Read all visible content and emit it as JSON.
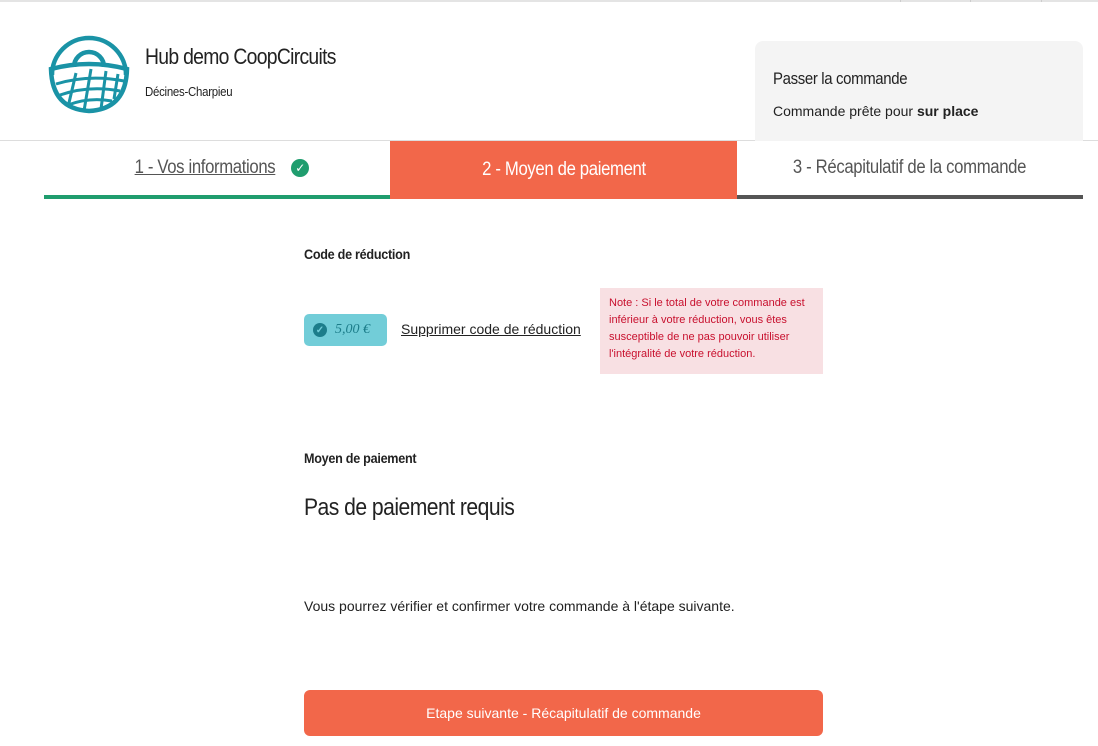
{
  "header": {
    "hub_name": "Hub demo CoopCircuits",
    "city": "Décines-Charpieu"
  },
  "cart": {
    "title": "Passer la commande",
    "subtitle_prefix": "Commande prête pour ",
    "subtitle_bold": "sur place"
  },
  "steps": [
    {
      "label": "1 - Vos informations",
      "status": "done"
    },
    {
      "label": "2 - Moyen de paiement",
      "status": "active"
    },
    {
      "label": "3 - Récapitulatif de la commande",
      "status": "pending"
    }
  ],
  "discount": {
    "heading": "Code de réduction",
    "amount": "5,00 €",
    "remove_label": "Supprimer code de réduction",
    "note": "Note : Si le total de votre commande est inférieur à votre réduction, vous êtes susceptible de ne pas pouvoir utiliser l'intégralité de votre réduction."
  },
  "payment": {
    "heading": "Moyen de paiement",
    "title": "Pas de paiement requis",
    "info": "Vous pourrez vérifier et confirmer votre commande à l'étape suivante."
  },
  "next_button": "Etape suivante - Récapitulatif de commande",
  "colors": {
    "accent": "#f2674a",
    "success": "#1f9d6e",
    "brand": "#1a93a6"
  }
}
